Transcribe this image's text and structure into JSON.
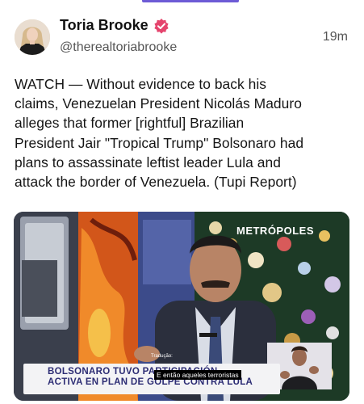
{
  "author": {
    "name": "Toria Brooke",
    "handle": "@therealtoriabrooke",
    "verified": true,
    "verified_color": "#e5446d"
  },
  "post": {
    "timestamp": "19m",
    "text_lines": [
      "WATCH — Without evidence to back his",
      "claims, Venezuelan President Nicolás Maduro",
      "alleges that former [rightful] Brazilian",
      "President Jair \"Tropical Trump\" Bolsonaro had",
      "plans to assassinate leftist leader Lula and",
      "attack the border of Venezuela. (Tupi Report)"
    ]
  },
  "media": {
    "logo_text": "METRÓPOLES",
    "translation_tag": "Tradução: ",
    "chyron_line1": "BOLSONARO TUVO PARTICIPACIÓN",
    "chyron_line2": "ACTIVA EN PLAN DE GOLPE CONTRA LULA",
    "subtitle": "E então aqueles terroristas"
  },
  "colors": {
    "accent": "#6d5bd6",
    "chyron_text": "#2c2c74"
  }
}
